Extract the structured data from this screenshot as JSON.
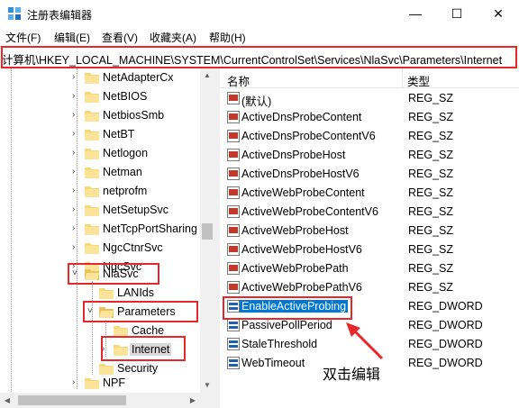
{
  "window": {
    "title": "注册表编辑器",
    "min_glyph": "—",
    "max_glyph": "☐",
    "close_glyph": "✕"
  },
  "menu": {
    "items": [
      "文件(F)",
      "编辑(E)",
      "查看(V)",
      "收藏夹(A)",
      "帮助(H)"
    ]
  },
  "address": {
    "path": "计算机\\HKEY_LOCAL_MACHINE\\SYSTEM\\CurrentControlSet\\Services\\NlaSvc\\Parameters\\Internet"
  },
  "tree": {
    "items": [
      {
        "label": "NetAdapterCx"
      },
      {
        "label": "NetBIOS"
      },
      {
        "label": "NetbiosSmb"
      },
      {
        "label": "NetBT"
      },
      {
        "label": "Netlogon"
      },
      {
        "label": "Netman"
      },
      {
        "label": "netprofm"
      },
      {
        "label": "NetSetupSvc"
      },
      {
        "label": "NetTcpPortSharing"
      },
      {
        "label": "NgcCtnrSvc"
      },
      {
        "label": "NgcSvc"
      },
      {
        "label": "NlaSvc"
      },
      {
        "label": "LANIds"
      },
      {
        "label": "Parameters"
      },
      {
        "label": "Cache"
      },
      {
        "label": "Internet"
      },
      {
        "label": "Security"
      },
      {
        "label": "NPF"
      }
    ]
  },
  "list": {
    "headers": {
      "name": "名称",
      "type": "类型"
    },
    "rows": [
      {
        "name": "(默认)",
        "type": "REG_SZ",
        "icon": "string-value-icon"
      },
      {
        "name": "ActiveDnsProbeContent",
        "type": "REG_SZ",
        "icon": "string-value-icon"
      },
      {
        "name": "ActiveDnsProbeContentV6",
        "type": "REG_SZ",
        "icon": "string-value-icon"
      },
      {
        "name": "ActiveDnsProbeHost",
        "type": "REG_SZ",
        "icon": "string-value-icon"
      },
      {
        "name": "ActiveDnsProbeHostV6",
        "type": "REG_SZ",
        "icon": "string-value-icon"
      },
      {
        "name": "ActiveWebProbeContent",
        "type": "REG_SZ",
        "icon": "string-value-icon"
      },
      {
        "name": "ActiveWebProbeContentV6",
        "type": "REG_SZ",
        "icon": "string-value-icon"
      },
      {
        "name": "ActiveWebProbeHost",
        "type": "REG_SZ",
        "icon": "string-value-icon"
      },
      {
        "name": "ActiveWebProbeHostV6",
        "type": "REG_SZ",
        "icon": "string-value-icon"
      },
      {
        "name": "ActiveWebProbePath",
        "type": "REG_SZ",
        "icon": "string-value-icon"
      },
      {
        "name": "ActiveWebProbePathV6",
        "type": "REG_SZ",
        "icon": "string-value-icon"
      },
      {
        "name": "EnableActiveProbing",
        "type": "REG_DWORD",
        "icon": "binary-value-icon"
      },
      {
        "name": "PassivePollPeriod",
        "type": "REG_DWORD",
        "icon": "binary-value-icon"
      },
      {
        "name": "StaleThreshold",
        "type": "REG_DWORD",
        "icon": "binary-value-icon"
      },
      {
        "name": "WebTimeout",
        "type": "REG_DWORD",
        "icon": "binary-value-icon"
      }
    ]
  },
  "annotation": {
    "text": "双击编辑"
  },
  "colors": {
    "selection": "#0078d7",
    "highlight_box": "#e8272b",
    "folder": "#f8d775",
    "arrow": "#e8272b"
  }
}
